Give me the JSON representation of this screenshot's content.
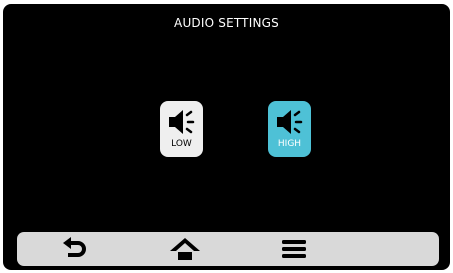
{
  "header": {
    "title": "AUDIO SETTINGS"
  },
  "audio_options": [
    {
      "label": "LOW",
      "icon": "speaker-icon",
      "selected": false,
      "background": "#efefef"
    },
    {
      "label": "HIGH",
      "icon": "speaker-icon",
      "selected": true,
      "background": "#4ec1d6"
    }
  ],
  "nav": {
    "items": [
      {
        "icon": "back-arrow-icon"
      },
      {
        "icon": "home-icon"
      },
      {
        "icon": "menu-icon"
      }
    ]
  },
  "colors": {
    "background": "#000000",
    "accent": "#4ec1d6",
    "inactive": "#efefef",
    "nav_bar": "#d9d9d9"
  }
}
